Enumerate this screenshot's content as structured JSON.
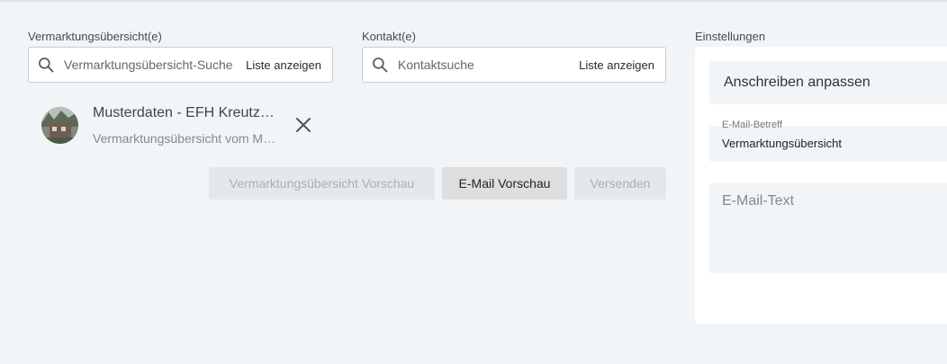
{
  "marketing": {
    "label": "Vermarktungsübersicht(e)",
    "placeholder": "Vermarktungsübersicht-Suche",
    "list_button": "Liste anzeigen"
  },
  "contact": {
    "label": "Kontakt(e)",
    "placeholder": "Kontaktsuche",
    "list_button": "Liste anzeigen"
  },
  "selected_item": {
    "title": "Musterdaten - EFH Kreutzer Straße",
    "subtitle": "Vermarktungsübersicht vom Muster"
  },
  "actions": {
    "preview_overview": "Vermarktungsübersicht Vorschau",
    "preview_email": "E-Mail Vorschau",
    "send": "Versenden"
  },
  "settings": {
    "label": "Einstellungen",
    "header": "Anschreiben anpassen",
    "subject_label": "E-Mail-Betreff",
    "subject_value": "Vermarktungsübersicht",
    "body_placeholder": "E-Mail-Text"
  },
  "icons": {
    "search": "search-icon",
    "close": "close-icon"
  },
  "colors": {
    "background": "#f1f5f8",
    "disabled_button": "#e2e8ec",
    "active_button": "#dedede"
  }
}
